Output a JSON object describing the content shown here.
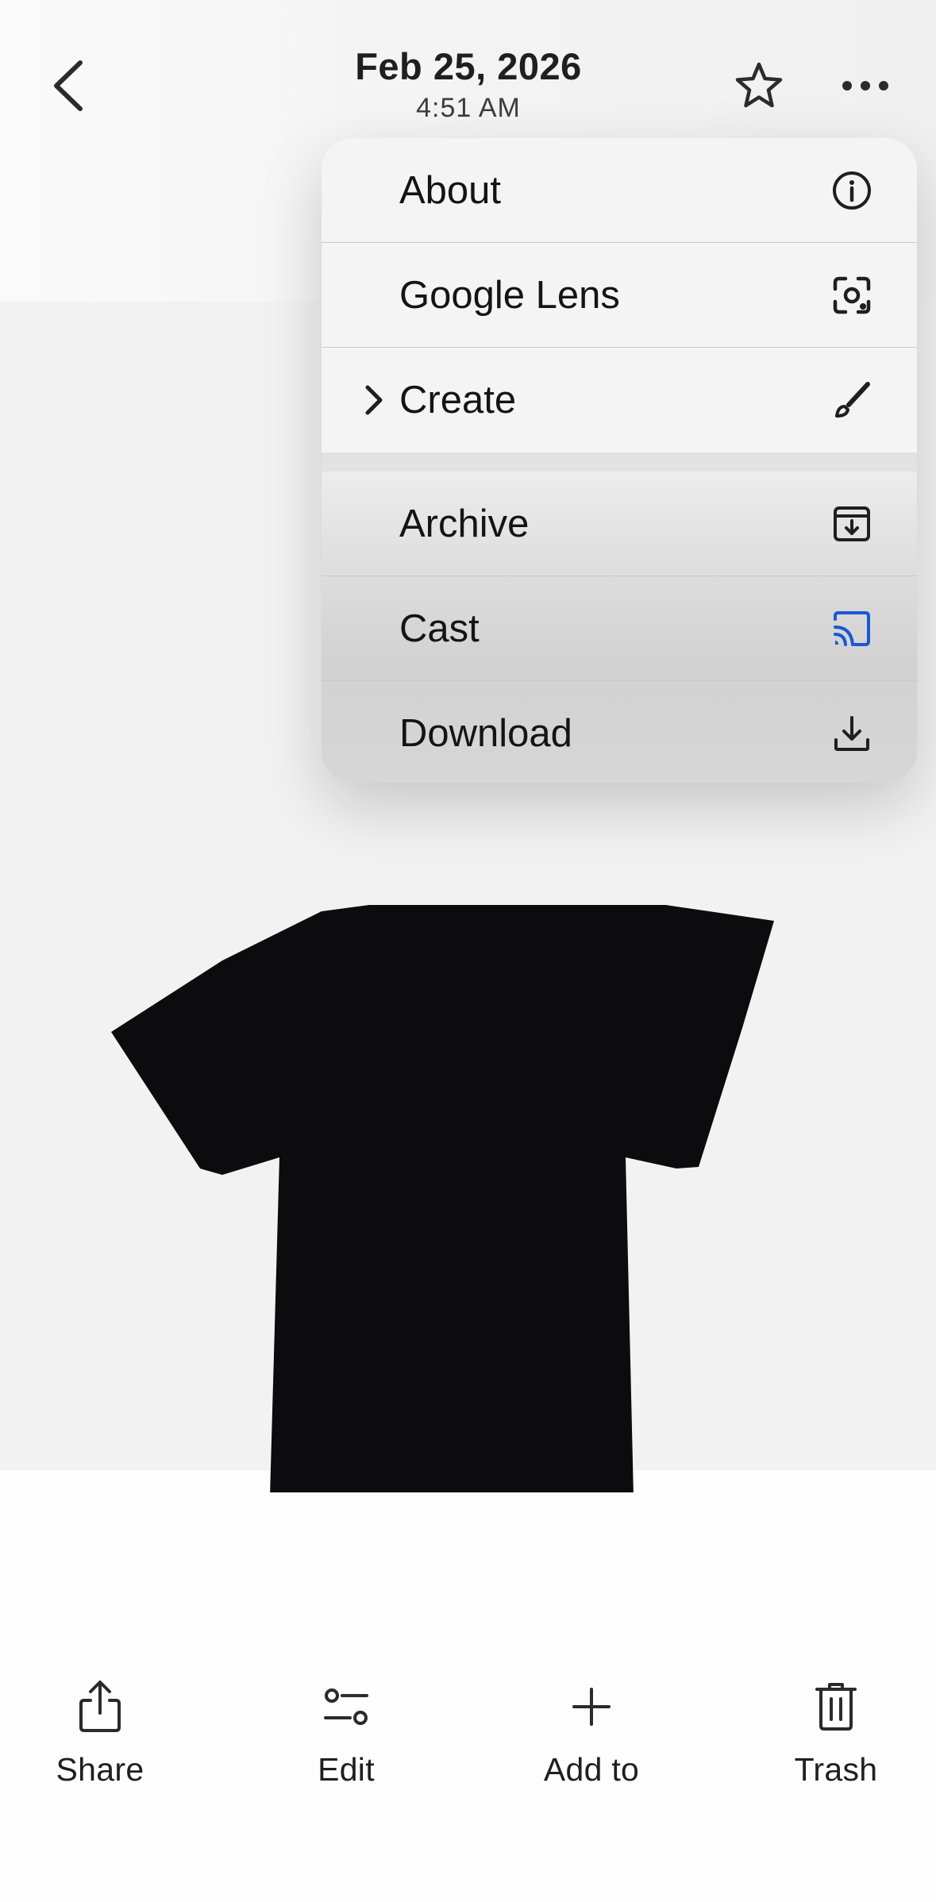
{
  "header": {
    "date": "Feb 25, 2026",
    "time": "4:51 AM",
    "back_icon": "chevron-left-icon",
    "favorite_icon": "star-outline-icon",
    "more_icon": "more-horizontal-icon"
  },
  "photo": {
    "subject_icon": "black-tshirt-image",
    "background_color": "#f2f2f2"
  },
  "menu": {
    "group1": [
      {
        "label": "About",
        "icon": "info-icon"
      },
      {
        "label": "Google Lens",
        "icon": "google-lens-icon"
      },
      {
        "label": "Create",
        "icon": "brush-icon",
        "has_submenu": true
      }
    ],
    "group2": [
      {
        "label": "Archive",
        "icon": "archive-icon"
      },
      {
        "label": "Cast",
        "icon": "cast-icon",
        "icon_color": "#1a57d4"
      },
      {
        "label": "Download",
        "icon": "download-icon"
      }
    ]
  },
  "bottom_bar": [
    {
      "label": "Share",
      "icon": "share-icon"
    },
    {
      "label": "Edit",
      "icon": "edit-sliders-icon"
    },
    {
      "label": "Add to",
      "icon": "plus-icon"
    },
    {
      "label": "Trash",
      "icon": "trash-icon"
    }
  ]
}
